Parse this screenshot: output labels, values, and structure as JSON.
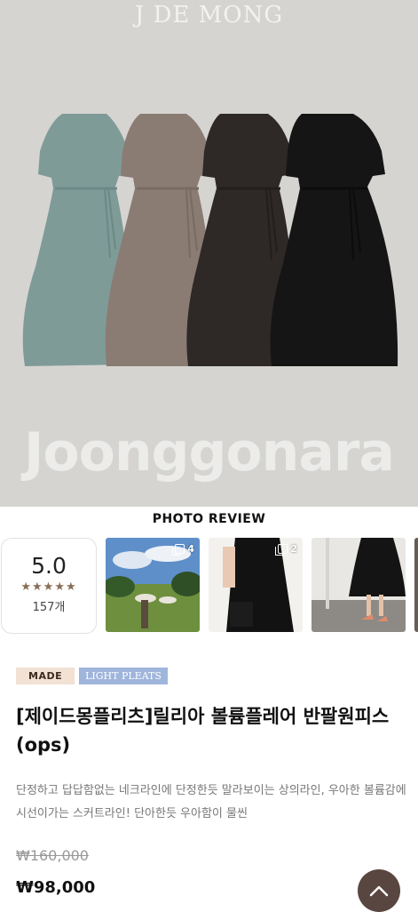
{
  "hero": {
    "brand": "J DE MONG",
    "watermark": "Joonggonara",
    "dress_colors": [
      "#7f9b98",
      "#8a7c73",
      "#2e2926",
      "#161515"
    ]
  },
  "reviews": {
    "section_title": "PHOTO REVIEW",
    "rating": "5.0",
    "stars": "★★★★★",
    "count": "157개",
    "photos": [
      {
        "name": "review-photo-1",
        "count": "4"
      },
      {
        "name": "review-photo-2",
        "count": "2"
      },
      {
        "name": "review-photo-3",
        "count": ""
      }
    ]
  },
  "product": {
    "badges": {
      "made": "MADE",
      "pleats": "LIGHT PLEATS"
    },
    "title": "[제이드몽플리츠]릴리아 볼륨플레어 반팔원피스(ops)",
    "description": "단정하고 답답함없는 네크라인에 단정한듯 말라보이는 상의라인, 우아한 볼륨감에 시선이가는 스커트라인! 단아한듯 우아함이 물씬",
    "original_price": "₩160,000",
    "sale_price": "₩98,000"
  },
  "colors": {
    "badge_made_bg": "#f3e1d3",
    "badge_pleats_bg": "#9fb5dc",
    "top_button_bg": "#5a4640",
    "star": "#8a6d55"
  },
  "icons": {
    "top_button": "chevron-up-icon",
    "photo_count": "multi-photo-icon"
  }
}
